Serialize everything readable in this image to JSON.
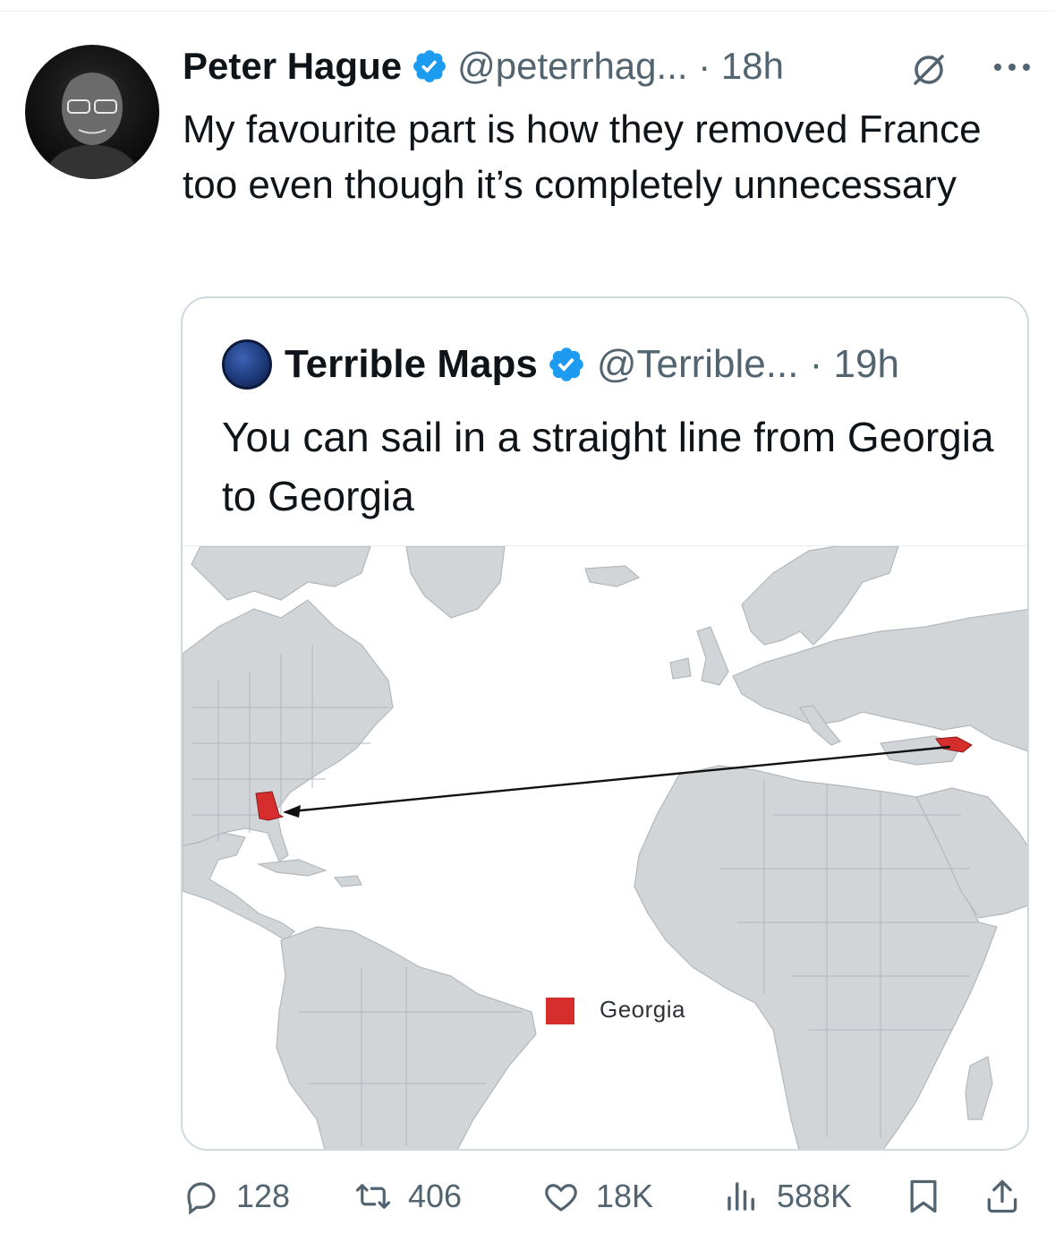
{
  "tweet": {
    "author_name": "Peter Hague",
    "handle_time": "@peterrhag... · 18h",
    "text": "My favourite part is how they removed France too even though it’s completely unnecessary",
    "counts": {
      "replies": "128",
      "reposts": "406",
      "likes": "18K",
      "views": "588K"
    }
  },
  "quote": {
    "author_name": "Terrible Maps",
    "handle_time": "@Terrible... · 19h",
    "text": "You can sail in a straight line from Georgia to Georgia",
    "map": {
      "legend_label": "Georgia",
      "highlight_color": "#d62d2d",
      "land_color": "#d1d5d8",
      "border_color": "#b3b8bc"
    }
  },
  "icons": [
    "verified-badge-icon",
    "grok-icon",
    "more-icon",
    "reply-icon",
    "repost-icon",
    "like-icon",
    "views-icon",
    "bookmark-icon",
    "share-icon"
  ]
}
